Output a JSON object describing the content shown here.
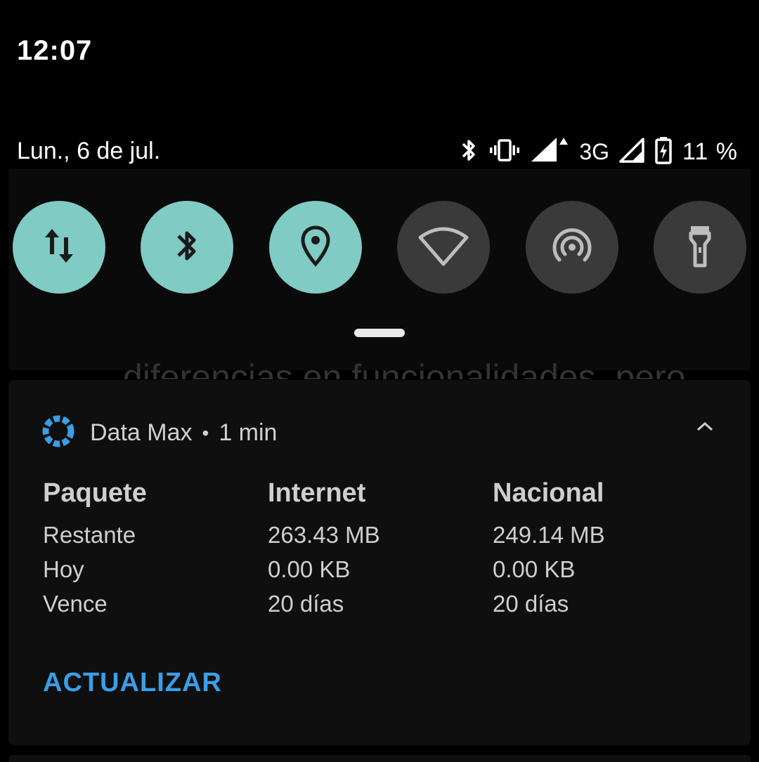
{
  "status_bar": {
    "time": "12:07"
  },
  "quick_settings": {
    "date": "Lun., 6 de jul.",
    "network_type": "3G",
    "battery": "11 %",
    "tiles": [
      {
        "name": "mobile-data",
        "icon": "data-transfer-icon",
        "state": "on"
      },
      {
        "name": "bluetooth",
        "icon": "bluetooth-icon",
        "state": "on"
      },
      {
        "name": "location",
        "icon": "location-pin-icon",
        "state": "on"
      },
      {
        "name": "wifi",
        "icon": "wifi-icon",
        "state": "off"
      },
      {
        "name": "hotspot",
        "icon": "hotspot-icon",
        "state": "off"
      },
      {
        "name": "flashlight",
        "icon": "flashlight-icon",
        "state": "off"
      }
    ],
    "colors": {
      "tile_on": "#80cbc4",
      "tile_off": "#3a3a3a"
    }
  },
  "background_text": "diferencias en funcionalidades, pero",
  "notification": {
    "app_name": "Data Max",
    "separator": "•",
    "time_ago": "1 min",
    "columns": [
      {
        "header": "Paquete",
        "rows": [
          "Restante",
          "Hoy",
          "Vence"
        ]
      },
      {
        "header": "Internet",
        "rows": [
          "263.43 MB",
          "0.00 KB",
          "20 días"
        ]
      },
      {
        "header": "Nacional",
        "rows": [
          "249.14 MB",
          "0.00 KB",
          "20 días"
        ]
      }
    ],
    "action_label": "ACTUALIZAR",
    "accent_color": "#3a9ee8"
  }
}
